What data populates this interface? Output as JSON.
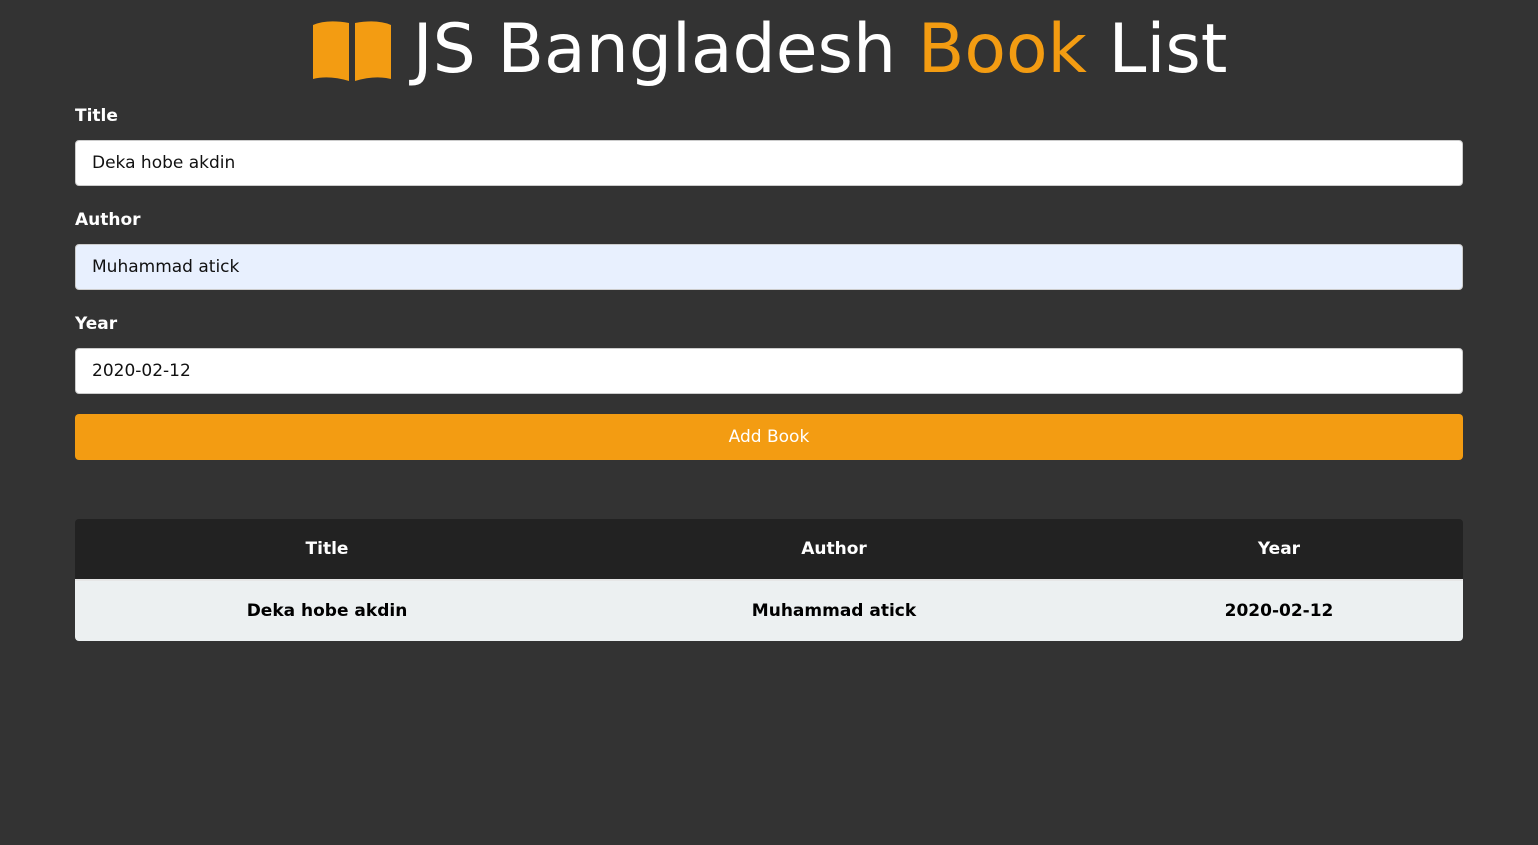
{
  "header": {
    "title_part1": "JS Bangladesh ",
    "title_accent": "Book",
    "title_part2": " List",
    "icon": "open-book-icon",
    "accent_color": "#f39c12"
  },
  "form": {
    "title_label": "Title",
    "title_value": "Deka hobe akdin",
    "author_label": "Author",
    "author_value": "Muhammad atick",
    "year_label": "Year",
    "year_value": "2020-02-12",
    "submit_label": "Add Book"
  },
  "table": {
    "headers": [
      "Title",
      "Author",
      "Year"
    ],
    "rows": [
      [
        "Deka hobe akdin",
        "Muhammad atick",
        "2020-02-12"
      ]
    ]
  },
  "colors": {
    "background": "#333333",
    "header_row": "#222222",
    "body_row": "#ecf0f1",
    "button": "#f39c12",
    "autofill_field": "#e8f0fe"
  }
}
